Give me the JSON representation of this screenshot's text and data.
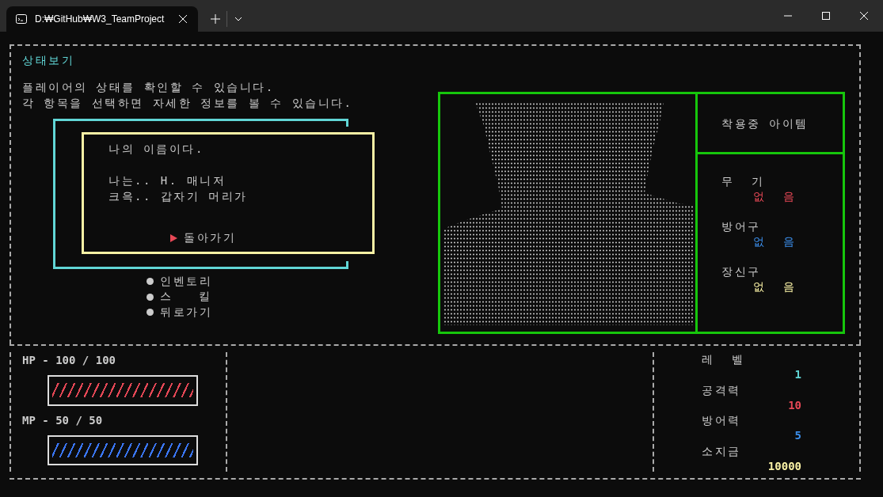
{
  "window": {
    "tab_title": "D:₩GitHub₩W3_TeamProject"
  },
  "screen": {
    "title": "상태보기",
    "description": [
      "플레이어의 상태를 확인할 수 있습니다.",
      "각 항목을 선택하면 자세한 정보를 볼 수 있습니다."
    ],
    "dialog": {
      "paragraphs": [
        [
          "나의 이름이다."
        ],
        [
          "나는.. H. 매니저",
          "크윽.. 갑자기 머리가"
        ]
      ],
      "choices": [
        {
          "label": "돌아가기",
          "selected": true
        }
      ]
    },
    "menu": [
      {
        "label": "인벤토리"
      },
      {
        "label": "스   킬"
      },
      {
        "label": "뒤로가기"
      }
    ],
    "equipment": {
      "header": "착용중 아이템",
      "slots": [
        {
          "name": "무  기",
          "value": "없  음",
          "color": "#e74856"
        },
        {
          "name": "방어구",
          "value": "없  음",
          "color": "#3b8eea"
        },
        {
          "name": "장신구",
          "value": "없  음",
          "color": "#f9f1a5"
        }
      ]
    },
    "gauges": [
      {
        "label": "HP - 100 / 100",
        "level": 1,
        "color": "#e74856"
      },
      {
        "label": "MP - 50 / 50",
        "level": 1,
        "color": "#3b78ff"
      }
    ],
    "stats": [
      {
        "label": "레  벨",
        "value": "1",
        "color": "#61d6d6"
      },
      {
        "label": "공격력",
        "value": "10",
        "color": "#e74856"
      },
      {
        "label": "방어력",
        "value": "5",
        "color": "#3b8eea"
      },
      {
        "label": "소지금",
        "value": "10000",
        "color": "#f9f1a5"
      }
    ]
  }
}
